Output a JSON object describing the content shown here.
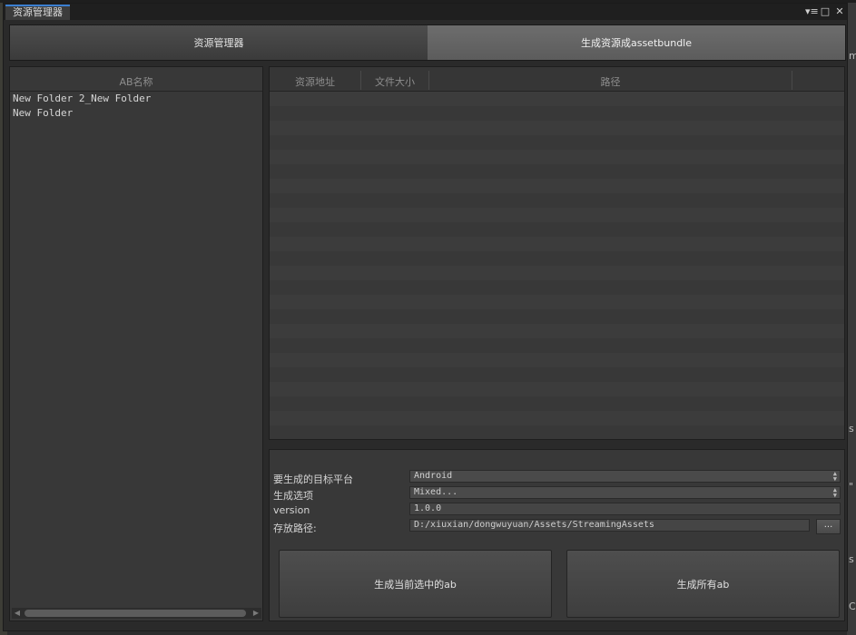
{
  "window": {
    "title": "资源管理器",
    "menu_glyph": "▾≡",
    "maximize_glyph": "□",
    "close_glyph": "✕"
  },
  "tabs": [
    {
      "label": "资源管理器",
      "active": true
    },
    {
      "label": "生成资源成assetbundle",
      "active": false
    }
  ],
  "ab_list": {
    "header": "AB名称",
    "items": [
      "New Folder 2_New Folder",
      "New Folder"
    ]
  },
  "asset_table": {
    "columns": [
      "资源地址",
      "文件大小",
      "路径"
    ],
    "rows": []
  },
  "build_settings": {
    "target_platform_label": "要生成的目标平台",
    "target_platform_value": "Android",
    "build_options_label": "生成选项",
    "build_options_value": "Mixed...",
    "version_label": "version",
    "version_value": "1.0.0",
    "output_path_label": "存放路径:",
    "output_path_value": "D:/xiuxian/dongwuyuan/Assets/StreamingAssets",
    "browse_label": "...",
    "build_selected_label": "生成当前选中的ab",
    "build_all_label": "生成所有ab"
  },
  "background": {
    "right_edge_text": [
      "m",
      "s",
      "\"",
      "s",
      "C"
    ]
  },
  "colors": {
    "title_tab_accent": "#3b7fd1",
    "window_bg": "#2a2a2a",
    "panel_bg": "#383838"
  }
}
